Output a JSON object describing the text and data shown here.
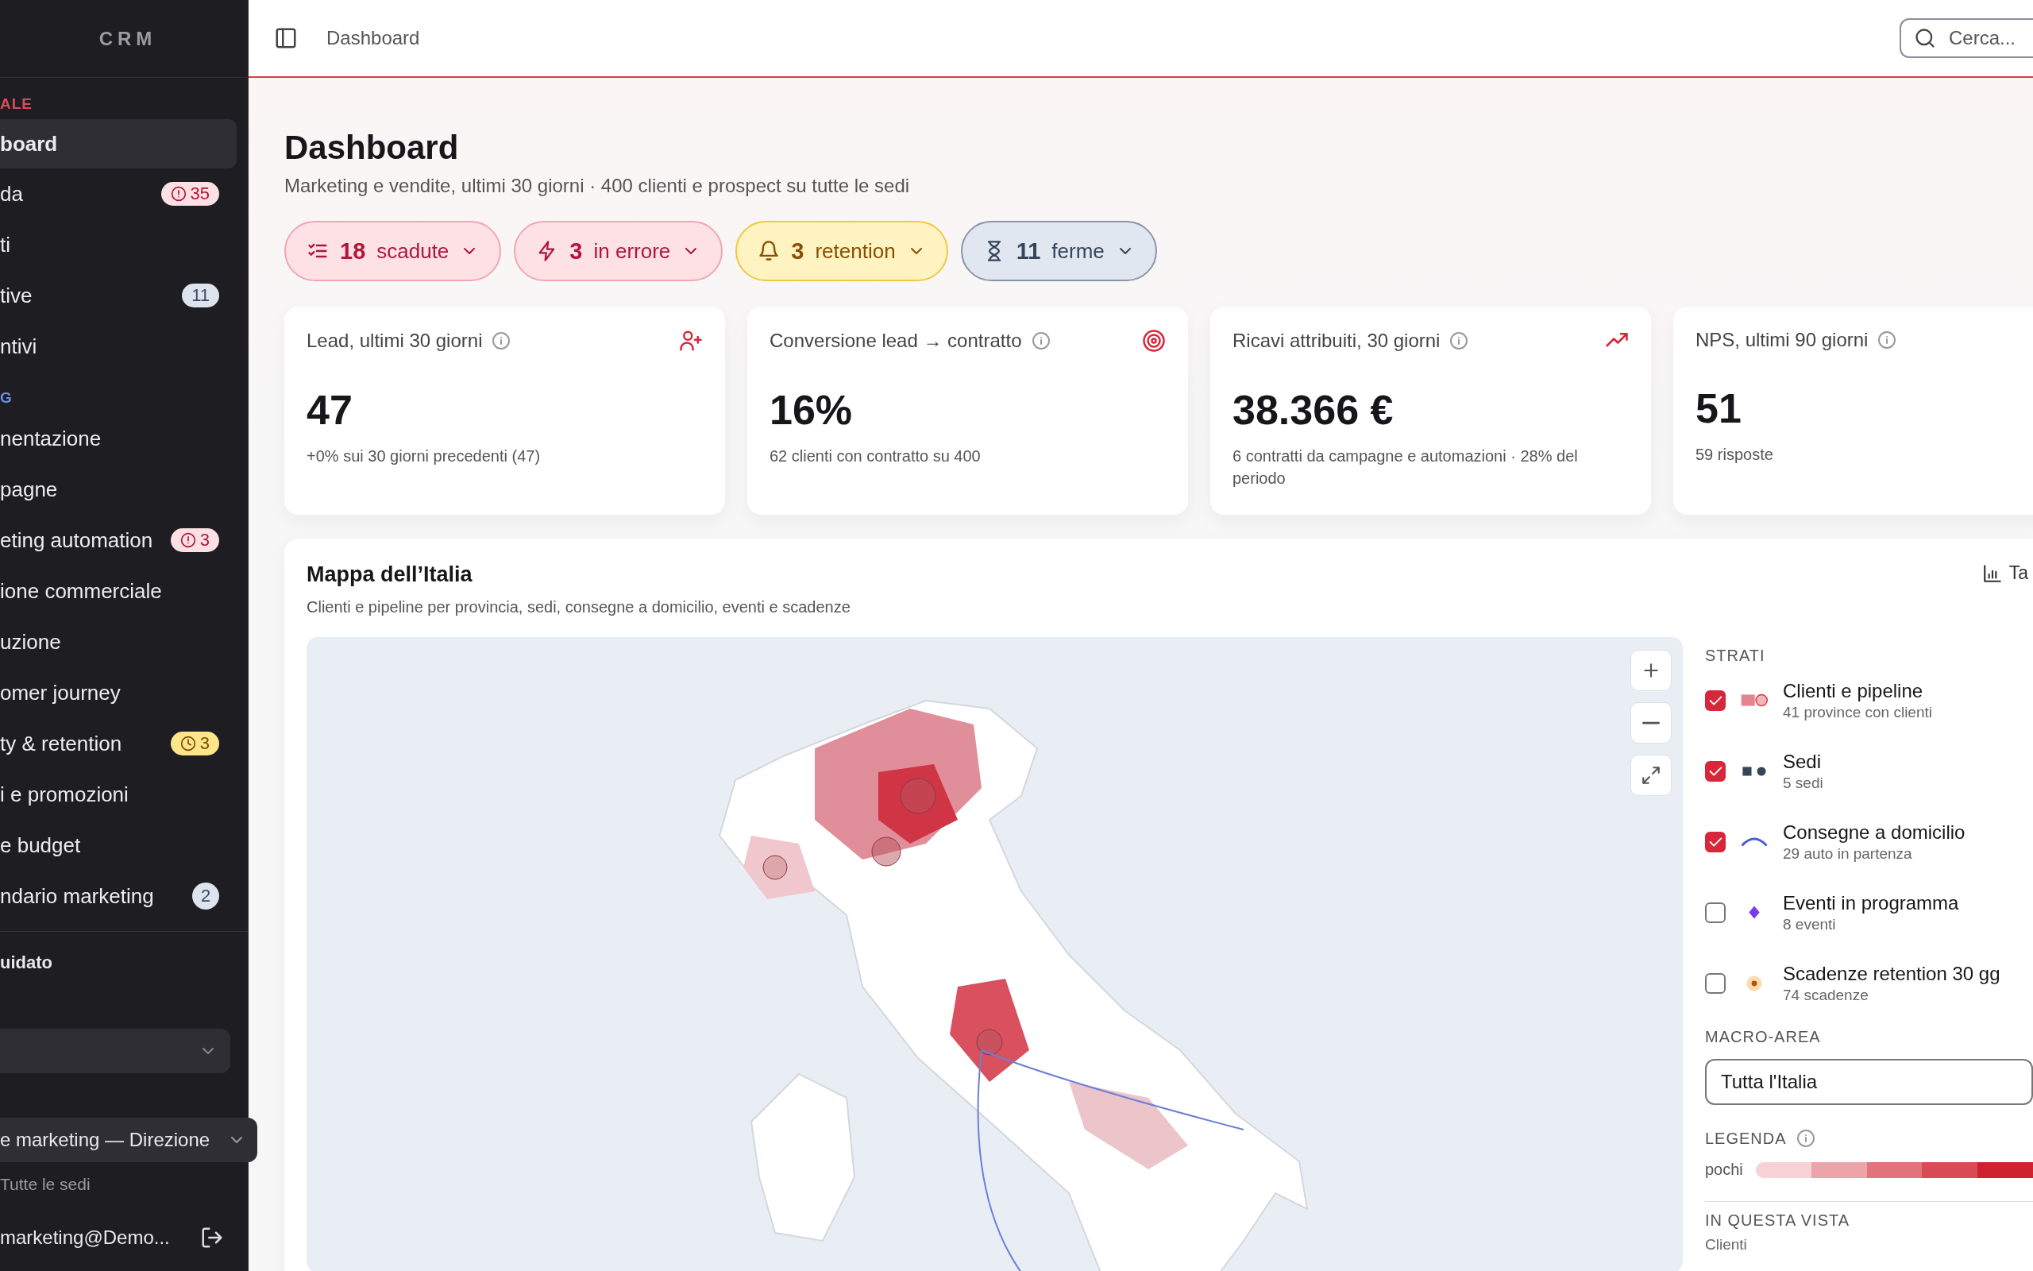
{
  "sidebar": {
    "brand": "CRM",
    "sections": [
      {
        "label": "ALE",
        "color": "#e0485a",
        "items": [
          {
            "label": "board",
            "selected": true
          },
          {
            "label": "da",
            "selected": false,
            "badge": {
              "text": "35",
              "kind": "alert"
            }
          },
          {
            "label": "ti",
            "selected": false
          },
          {
            "label": "tive",
            "selected": false,
            "badge": {
              "text": "11",
              "kind": "count"
            }
          },
          {
            "label": "ntivi",
            "selected": false
          }
        ]
      },
      {
        "label": "G",
        "color": "#6d8fe0",
        "items": [
          {
            "label": "nentazione",
            "selected": false
          },
          {
            "label": "pagne",
            "selected": false
          },
          {
            "label": "eting automation",
            "selected": false,
            "badge": {
              "text": "3",
              "kind": "alert"
            }
          },
          {
            "label": "ione commerciale",
            "selected": false
          },
          {
            "label": "uzione",
            "selected": false
          },
          {
            "label": "omer journey",
            "selected": false
          },
          {
            "label": "ty & retention",
            "selected": false,
            "badge": {
              "text": "3",
              "kind": "clock"
            }
          },
          {
            "label": "i e promozioni",
            "selected": false
          },
          {
            "label": "e budget",
            "selected": false
          },
          {
            "label": "ndario marketing",
            "selected": false,
            "badge": {
              "text": "2",
              "kind": "round"
            }
          }
        ]
      }
    ],
    "guide": "uidato",
    "role": "e marketing — Direzione",
    "scope": "Tutte le sedi",
    "email": "marketing@Demo..."
  },
  "header": {
    "breadcrumb": "Dashboard",
    "search": {
      "placeholder": "Cerca..."
    }
  },
  "page": {
    "title": "Dashboard",
    "subtitle": "Marketing e vendite, ultimi 30 giorni · 400 clienti e prospect su tutte le sedi"
  },
  "chips": [
    {
      "kind": "overdue",
      "count": "18",
      "label": "scadute"
    },
    {
      "kind": "error",
      "count": "3",
      "label": "in errore"
    },
    {
      "kind": "retention",
      "count": "3",
      "label": "retention"
    },
    {
      "kind": "stalled",
      "count": "11",
      "label": "ferme"
    }
  ],
  "cards": [
    {
      "kind": "lead",
      "title": "Lead, ultimi 30 giorni",
      "value": "47",
      "note": "+0% sui 30 giorni precedenti (47)"
    },
    {
      "kind": "conversion",
      "title": "Conversione lead → contratto",
      "value": "16%",
      "note": "62 clienti con contratto su 400"
    },
    {
      "kind": "revenue",
      "title": "Ricavi attribuiti, 30 giorni",
      "value": "38.366 €",
      "note": "6 contratti da campagne e automazioni · 28% del periodo"
    },
    {
      "kind": "none",
      "title": "NPS, ultimi 90 giorni",
      "value": "51",
      "note": "59 risposte"
    }
  ],
  "map": {
    "title": "Mappa dell’Italia",
    "subtitle": "Clienti e pipeline per provincia, sedi, consegne a domicilio, eventi e scadenze",
    "action": "Ta",
    "layers_label": "STRATI",
    "layers": [
      {
        "kind": "area",
        "name": "Clienti e pipeline",
        "detail": "41 province con clienti",
        "checked": true
      },
      {
        "kind": "office",
        "name": "Sedi",
        "detail": "5 sedi",
        "checked": true
      },
      {
        "kind": "route",
        "name": "Consegne a domicilio",
        "detail": "29 auto in partenza",
        "checked": true
      },
      {
        "kind": "event",
        "name": "Eventi in programma",
        "detail": "8 eventi",
        "checked": false
      },
      {
        "kind": "deadline",
        "name": "Scadenze retention 30 gg",
        "detail": "74 scadenze",
        "checked": false
      }
    ],
    "area_label": "MACRO-AREA",
    "area_value": "Tutta l'Italia",
    "legend_label": "LEGENDA",
    "legend_low": "pochi",
    "view_label": "IN QUESTA VISTA",
    "view_first": "Clienti"
  }
}
